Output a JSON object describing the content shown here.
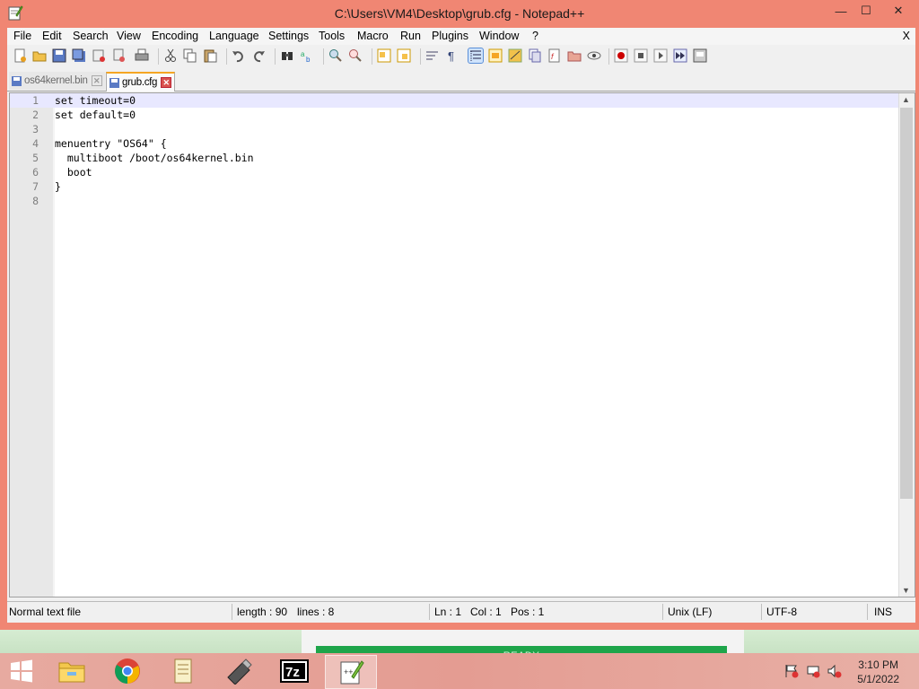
{
  "window": {
    "title": "C:\\Users\\VM4\\Desktop\\grub.cfg - Notepad++",
    "minimize_glyph": "—",
    "maximize_glyph": "☐",
    "close_glyph": "✕"
  },
  "menubar": {
    "items": [
      "File",
      "Edit",
      "Search",
      "View",
      "Encoding",
      "Language",
      "Settings",
      "Tools",
      "Macro",
      "Run",
      "Plugins",
      "Window",
      "?"
    ],
    "close_label": "X"
  },
  "tabs": [
    {
      "label": "os64kernel.bin",
      "active": false
    },
    {
      "label": "grub.cfg",
      "active": true
    }
  ],
  "editor": {
    "lines": [
      {
        "num": "1",
        "text": "set timeout=0"
      },
      {
        "num": "2",
        "text": "set default=0"
      },
      {
        "num": "3",
        "text": ""
      },
      {
        "num": "4",
        "text": "menuentry \"OS64\" {"
      },
      {
        "num": "5",
        "text": "  multiboot /boot/os64kernel.bin"
      },
      {
        "num": "6",
        "text": "  boot"
      },
      {
        "num": "7",
        "text": "}"
      },
      {
        "num": "8",
        "text": ""
      }
    ]
  },
  "statusbar": {
    "file_type": "Normal text file",
    "length": "length : 90",
    "lines": "lines : 8",
    "ln": "Ln : 1",
    "col": "Col : 1",
    "pos": "Pos : 1",
    "eol": "Unix (LF)",
    "encoding": "UTF-8",
    "mode": "INS"
  },
  "background": {
    "progress_text": "READY"
  },
  "taskbar": {
    "time": "3:10 PM",
    "date": "5/1/2022"
  },
  "colors": {
    "accent_active_tab": "#f5a623",
    "window_frame": "#f08673",
    "progress": "#1ea54a"
  }
}
